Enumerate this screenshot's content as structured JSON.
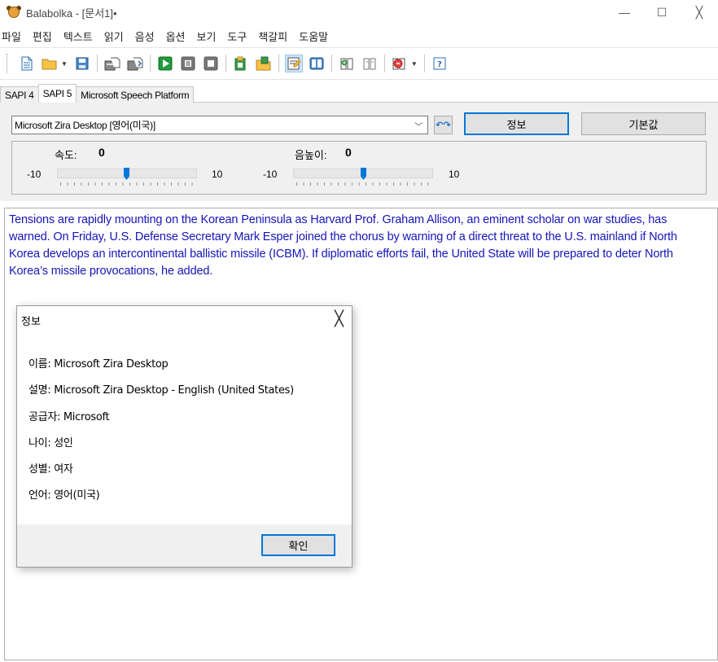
{
  "window": {
    "title": "Balabolka - [문서1]•",
    "controls": {
      "minimize": "—",
      "maximize": "☐",
      "close": "╳"
    }
  },
  "menu": [
    "파일",
    "편집",
    "텍스트",
    "읽기",
    "음성",
    "옵션",
    "보기",
    "도구",
    "책갈피",
    "도움말"
  ],
  "toolbar": {
    "icons": [
      "new-document-icon",
      "open-folder-icon",
      "save-icon",
      "export-audio-icon",
      "export-file-icon",
      "play-icon",
      "pause-icon",
      "stop-icon",
      "speak-clipboard-icon",
      "audio-folder-icon",
      "text-properties-icon",
      "read-text-icon",
      "bookmark-add-icon",
      "bookmark-icon",
      "voice-menu-icon",
      "help-icon"
    ],
    "accent": "#1f9a3a"
  },
  "tabs": [
    "SAPI 4",
    "SAPI 5",
    "Microsoft Speech Platform"
  ],
  "voice": {
    "selected": "Microsoft Zira Desktop [영어(미국)]",
    "info_label": "정보",
    "default_label": "기본값"
  },
  "sliders": {
    "rate": {
      "label": "속도:",
      "value": "0",
      "min": "-10",
      "max": "10"
    },
    "pitch": {
      "label": "음높이:",
      "value": "0",
      "min": "-10",
      "max": "10"
    }
  },
  "editor": {
    "text": "Tensions are rapidly mounting on the Korean Peninsula as Harvard Prof. Graham Allison, an eminent scholar on war studies, has warned. On Friday, U.S. Defense Secretary Mark Esper joined the chorus by warning of a direct threat to the U.S. mainland if North Korea develops an intercontinental ballistic missile (ICBM). If diplomatic efforts fail, the United State will be prepared to deter North Korea’s missile provocations, he added.",
    "text_color": "#1515b9"
  },
  "dialog": {
    "title": "정보",
    "close": "╳",
    "rows": [
      "이름: Microsoft Zira Desktop",
      "설명: Microsoft Zira Desktop - English (United States)",
      "공급자: Microsoft",
      "나이: 성인",
      "성별: 여자",
      "언어: 영어(미국)"
    ],
    "ok_label": "확인"
  },
  "colors": {
    "focus_blue": "#0078d7",
    "panel_gray": "#f0f0f0"
  }
}
